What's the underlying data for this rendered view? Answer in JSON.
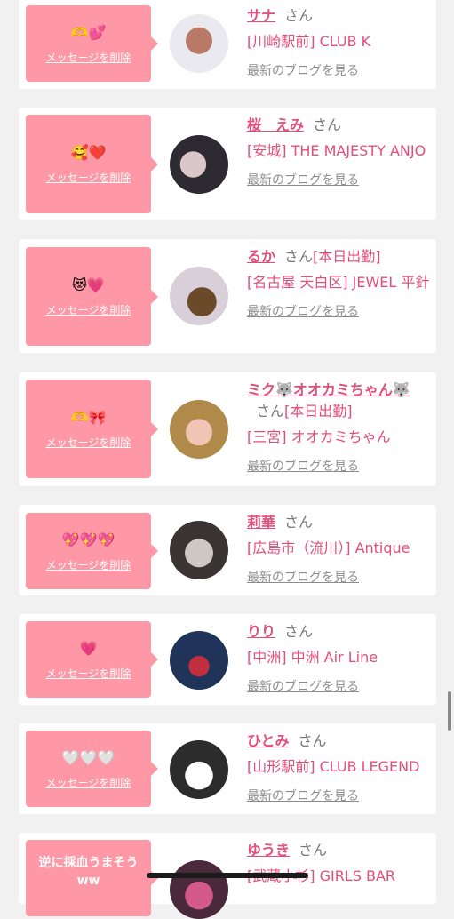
{
  "delete_label": "メッセージを削除",
  "san_label": "さん",
  "blog_label": "最新のブログを見る",
  "colors": {
    "accent": "#e34d7a",
    "bubble": "#ff98a6",
    "background": "#f1f1f1"
  },
  "cards": [
    {
      "emoji": "🫶💕",
      "name": "サナ",
      "status": "",
      "shop": "[川崎駅前] CLUB K"
    },
    {
      "emoji": "🥰❤️",
      "name": "桜　えみ",
      "status": "",
      "shop": "[安城] THE MAJESTY ANJO"
    },
    {
      "emoji": "😻💗",
      "name": "るか",
      "status": "[本日出勤]",
      "shop": "[名古屋 天白区] JEWEL 平針"
    },
    {
      "emoji": "🫶🎀",
      "name": "ミク🐺オオカミちゃん🐺",
      "status": "[本日出勤]",
      "shop": "[三宮] オオカミちゃん"
    },
    {
      "emoji": "💖💖💖",
      "name": "莉華",
      "status": "",
      "shop": "[広島市（流川）] Antique"
    },
    {
      "emoji": "💗",
      "name": "りり",
      "status": "",
      "shop": "[中洲] 中洲 Air Line"
    },
    {
      "emoji": "🤍🤍🤍",
      "name": "ひとみ",
      "status": "",
      "shop": "[山形駅前] CLUB LEGEND"
    },
    {
      "emoji": "逆に採血うまそう ww",
      "name": "ゆうき",
      "status": "",
      "shop": "[武蔵小杉] GIRLS BAR"
    }
  ]
}
